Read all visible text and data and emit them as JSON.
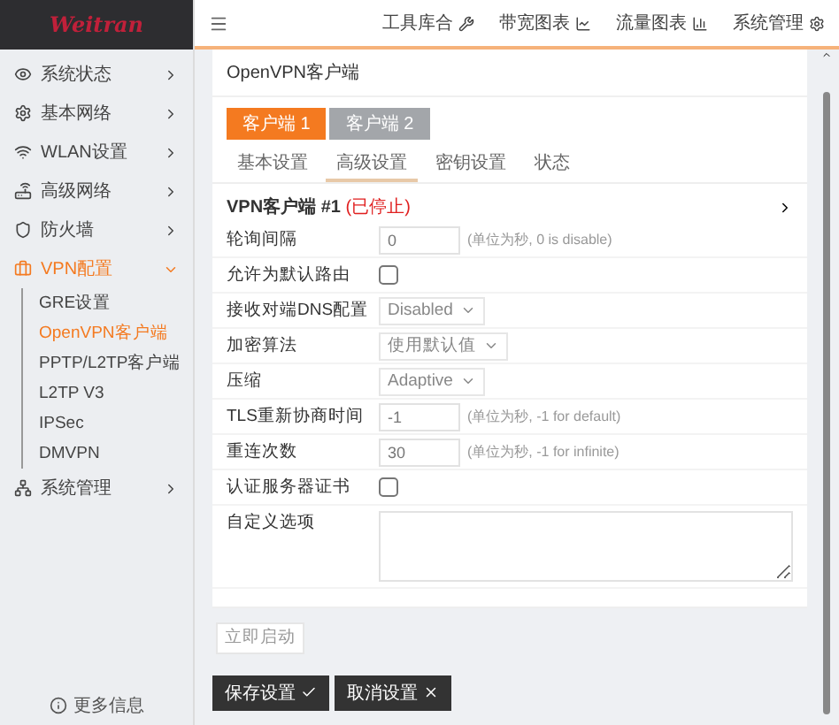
{
  "logo": "Weitran",
  "sidebar": {
    "items": [
      {
        "label": "系统状态",
        "expanded": false,
        "selected": false
      },
      {
        "label": "基本网络",
        "expanded": false,
        "selected": false
      },
      {
        "label": "WLAN设置",
        "expanded": false,
        "selected": false
      },
      {
        "label": "高级网络",
        "expanded": false,
        "selected": false
      },
      {
        "label": "防火墙",
        "expanded": false,
        "selected": false
      },
      {
        "label": "VPN配置",
        "expanded": true,
        "selected": true,
        "children": [
          {
            "label": "GRE设置",
            "selected": false
          },
          {
            "label": "OpenVPN客户端",
            "selected": true
          },
          {
            "label": "PPTP/L2TP客户端",
            "selected": false
          },
          {
            "label": "L2TP V3",
            "selected": false
          },
          {
            "label": "IPSec",
            "selected": false
          },
          {
            "label": "DMVPN",
            "selected": false
          }
        ]
      },
      {
        "label": "系统管理",
        "expanded": false,
        "selected": false
      }
    ],
    "footer": "更多信息"
  },
  "header": {
    "links": [
      "工具库合",
      "带宽图表",
      "流量图表",
      "系统管理"
    ]
  },
  "page_title": "OpenVPN客户端",
  "client_tabs": [
    {
      "label": "客户端 1",
      "selected": true
    },
    {
      "label": "客户端 2",
      "selected": false
    }
  ],
  "sub_tabs": [
    {
      "label": "基本设置",
      "selected": false
    },
    {
      "label": "高级设置",
      "selected": true
    },
    {
      "label": "密钥设置",
      "selected": false
    },
    {
      "label": "状态",
      "selected": false
    }
  ],
  "section": {
    "title": "VPN客户端 #1",
    "status": "(已停止)"
  },
  "fields": [
    {
      "kind": "text",
      "label": "轮询间隔",
      "value": "0",
      "hint": "(单位为秒, 0 is disable)"
    },
    {
      "kind": "checkbox",
      "label": "允许为默认路由",
      "checked": false
    },
    {
      "kind": "select",
      "label": "接收对端DNS配置",
      "value": "Disabled"
    },
    {
      "kind": "select",
      "label": "加密算法",
      "value": "使用默认值"
    },
    {
      "kind": "select",
      "label": "压缩",
      "value": "Adaptive"
    },
    {
      "kind": "text",
      "label": "TLS重新协商时间",
      "value": "-1",
      "hint": "(单位为秒, -1 for default)"
    },
    {
      "kind": "text",
      "label": "重连次数",
      "value": "30",
      "hint": "(单位为秒, -1 for infinite)"
    },
    {
      "kind": "checkbox",
      "label": "认证服务器证书",
      "checked": false
    },
    {
      "kind": "textarea",
      "label": "自定义选项"
    }
  ],
  "restart_button": "立即启动",
  "buttons": [
    {
      "label": "保存设置",
      "kind": "save"
    },
    {
      "label": "取消设置",
      "kind": "cancel"
    }
  ]
}
